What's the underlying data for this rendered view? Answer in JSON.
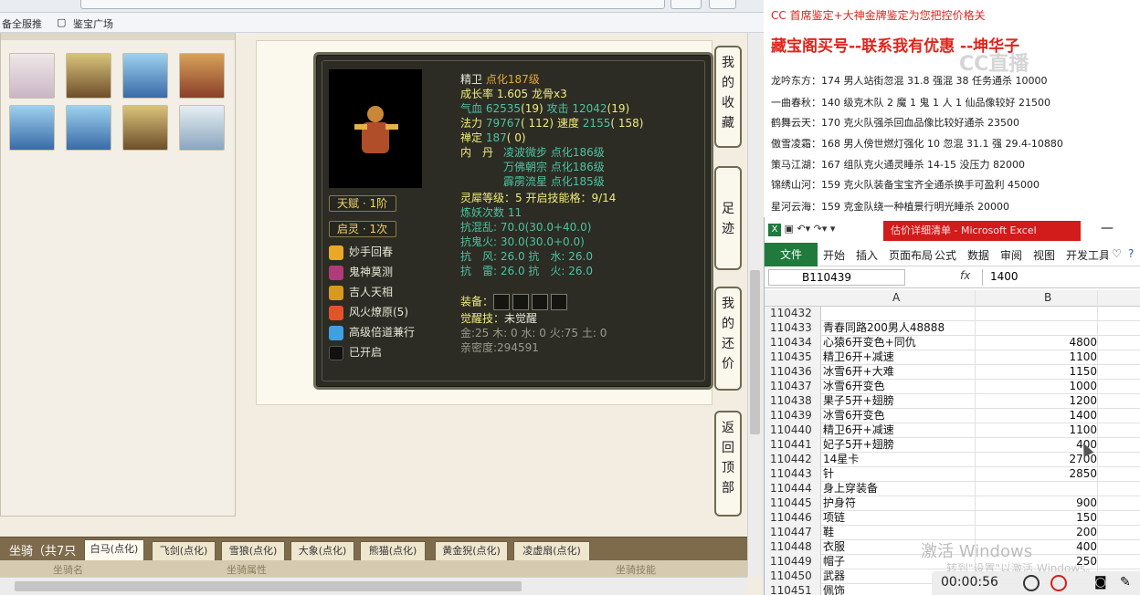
{
  "favbar": {
    "item1": "备全服推",
    "item2": "鉴宝广场",
    "sep": "·"
  },
  "card": {
    "name": "精卫",
    "level": "点化187级",
    "growth": "成长率 1.605 龙骨x3",
    "hp": {
      "label": "气血",
      "value": "62535",
      "sub": "(19)",
      "label2": "攻击",
      "value2": "12042",
      "sub2": "(19)"
    },
    "mp": {
      "label": "法力",
      "value": "79767",
      "sub": "( 112)",
      "label2": "速度",
      "value2": "2155",
      "sub2": "( 158)"
    },
    "zen": {
      "label": "禅定",
      "value": "187",
      "sub": "( 0)"
    },
    "dan_label": "内　丹",
    "dan": [
      {
        "name": "凌波微步",
        "lv": "点化186级"
      },
      {
        "name": "万佛朝宗",
        "lv": "点化186级"
      },
      {
        "name": "霹雳流星",
        "lv": "点化185级"
      }
    ],
    "lingxi": "灵犀等级：5 开启技能格：9/14",
    "lianyao": "炼妖次数 11",
    "resist": [
      "抗混乱: 70.0(30.0+40.0)",
      "抗鬼火: 30.0(30.0+0.0)",
      "抗　风: 26.0 抗　水: 26.0",
      "抗　雷: 26.0 抗　火: 26.0"
    ],
    "equip_label": "装备：",
    "awaken_label": "觉醒技：",
    "awaken_value": "未觉醒",
    "elements": "金:25 木: 0 水: 0 火:75 土: 0",
    "intimacy": "亲密度:294591",
    "talent": "天赋 · 1阶",
    "spirit": "启灵 · 1次",
    "skills": [
      "妙手回春",
      "鬼神莫测",
      "吉人天相",
      "风火燎原(5)",
      "高级倍道兼行",
      "已开启"
    ]
  },
  "sidebtns": [
    [
      "我",
      "的",
      "收",
      "藏"
    ],
    [
      "足",
      "迹"
    ],
    [
      "我",
      "的",
      "还",
      "价"
    ],
    [
      "返",
      "回",
      "顶",
      "部"
    ]
  ],
  "mount": {
    "label": "坐骑（共7只",
    "tabs": [
      "白马(点化)",
      "飞剑(点化)",
      "雪狼(点化)",
      "大象(点化)",
      "熊猫(点化)",
      "黄金猊(点化)",
      "凌虚扇(点化)"
    ],
    "sub": [
      "坐骑名",
      "坐骑属性",
      "坐骑技能"
    ]
  },
  "notes": {
    "header": "CC 首席鉴定+大神金牌鉴定为您把控价格关",
    "big": "藏宝阁买号--联系我有优惠 --坤华子",
    "lines": [
      "龙吟东方：174 男人站街忽混 31.8 强混 38 任务通杀 10000",
      "一曲春秋：140 级克木队 2 魔 1 鬼 1 人 1 仙品像较好 21500",
      "鹤舞云天：170 克火队强杀回血品像比较好通杀 23500",
      "傲雪凌霜：168 男人傍世燃灯强化 10 忽混 31.1 强 29.4-10880",
      "策马江湖：167 组队克火通灵睡杀 14-15 没压力 82000",
      "锦绣山河：159 克火队装备宝宝齐全通杀换手可盈利 45000",
      "星河云海：159 克金队绕一种植景行明光睡杀 20000"
    ],
    "watermark": "CC直播"
  },
  "excel": {
    "title": "估价详细清单 - Microsoft Excel",
    "file": "文件",
    "tabs": [
      "开始",
      "插入",
      "页面布局",
      "公式",
      "数据",
      "审阅",
      "视图",
      "开发工具"
    ],
    "namebox": "B110439",
    "fx": "fx",
    "formula_value": "1400",
    "col_a": "A",
    "col_b": "B",
    "rows": [
      {
        "n": "110432",
        "a": "",
        "b": ""
      },
      {
        "n": "110433",
        "a": "青春同路200男人48888",
        "b": ""
      },
      {
        "n": "110434",
        "a": "心猿6开变色+同仇",
        "b": "4800"
      },
      {
        "n": "110435",
        "a": "精卫6开+减速",
        "b": "1100"
      },
      {
        "n": "110436",
        "a": "冰雪6开+大难",
        "b": "1150"
      },
      {
        "n": "110437",
        "a": "冰雪6开变色",
        "b": "1000"
      },
      {
        "n": "110438",
        "a": "果子5开+翅膀",
        "b": "1200"
      },
      {
        "n": "110439",
        "a": "冰雪6开变色",
        "b": "1400"
      },
      {
        "n": "110440",
        "a": "精卫6开+减速",
        "b": "1100"
      },
      {
        "n": "110441",
        "a": "妃子5开+翅膀",
        "b": "400"
      },
      {
        "n": "110442",
        "a": "14星卡",
        "b": "2700"
      },
      {
        "n": "110443",
        "a": "针",
        "b": "2850"
      },
      {
        "n": "110444",
        "a": "身上穿装备",
        "b": ""
      },
      {
        "n": "110445",
        "a": "护身符",
        "b": "900"
      },
      {
        "n": "110446",
        "a": "项链",
        "b": "150"
      },
      {
        "n": "110447",
        "a": "鞋",
        "b": "200"
      },
      {
        "n": "110448",
        "a": "衣服",
        "b": "400"
      },
      {
        "n": "110449",
        "a": "帽子",
        "b": "250"
      },
      {
        "n": "110450",
        "a": "武器",
        "b": ""
      },
      {
        "n": "110451",
        "a": "佩饰",
        "b": ""
      }
    ]
  },
  "win": {
    "activate": "激活 Windows",
    "hint": "转到\"设置\"以激活 Windows。"
  },
  "recorder": {
    "time": "00:00:56"
  }
}
